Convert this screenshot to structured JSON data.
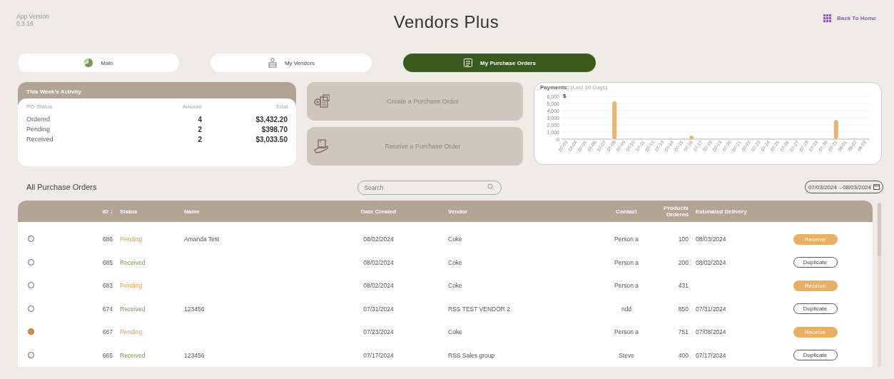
{
  "header": {
    "version_label": "App Version",
    "version": "0.3.16",
    "title": "Vendors Plus",
    "back_link": "Back To Home"
  },
  "tabs": [
    {
      "label": "Main",
      "selected": false
    },
    {
      "label": "My Vendors",
      "selected": false
    },
    {
      "label": "My Purchase Orders",
      "selected": true
    }
  ],
  "activity": {
    "title": "This Week's Activity",
    "columns": [
      "PO Status",
      "Amount",
      "Total"
    ],
    "rows": [
      {
        "status": "Ordered",
        "amount": "4",
        "total": "$3,432.20"
      },
      {
        "status": "Pending",
        "amount": "2",
        "total": "$398.70"
      },
      {
        "status": "Received",
        "amount": "2",
        "total": "$3,033.50"
      }
    ]
  },
  "actions": [
    {
      "label": "Create a Purchase Order"
    },
    {
      "label": "Receive a Purchase Order"
    }
  ],
  "payments": {
    "subtitle": "(Last 30 Days)",
    "chart_data": {
      "type": "bar",
      "title": "Payments:",
      "ylabel": "$",
      "categories": [
        "07-03",
        "07-04",
        "07-05",
        "07-06",
        "07-07",
        "07-08",
        "07-09",
        "07-10",
        "07-11",
        "07-12",
        "07-13",
        "07-14",
        "07-15",
        "07-16",
        "07-17",
        "07-18",
        "07-19",
        "07-20",
        "07-21",
        "07-22",
        "07-23",
        "07-24",
        "07-25",
        "07-26",
        "07-27",
        "07-28",
        "07-29",
        "07-30",
        "07-31",
        "08-01",
        "08-02",
        "08-03"
      ],
      "grid": true,
      "series": [
        {
          "color": "#e8b56e",
          "values": [
            0,
            0,
            0,
            0,
            0,
            5300,
            0,
            0,
            0,
            0,
            0,
            0,
            0,
            500,
            0,
            0,
            0,
            0,
            0,
            0,
            0,
            0,
            0,
            0,
            0,
            0,
            0,
            0,
            2700,
            0,
            0,
            0
          ]
        }
      ],
      "ylim": [
        0,
        6000
      ],
      "yticks": [
        0,
        {
          "value": 1000,
          "label": "1,000"
        },
        {
          "value": 2000,
          "label": "2,000"
        },
        {
          "value": 3000,
          "label": "3,000"
        },
        {
          "value": 4000,
          "label": "4,000"
        },
        {
          "value": 5000,
          "label": "5,000"
        },
        {
          "value": 6000,
          "label": "6,000"
        }
      ]
    }
  },
  "orders": {
    "title": "All Purchase Orders",
    "search": {
      "placeholder": "Search"
    },
    "date_range": "07/03/2024→08/03/2024",
    "columns": [
      "ID ↓",
      "Status",
      "Name",
      "Date Created",
      "Vendor",
      "Contact",
      "Products Ordered",
      "Estimated Delivery"
    ],
    "rows": [
      {
        "selected": false,
        "id": "686",
        "status": "Pending",
        "kind": "pending",
        "name": "Amanda Test",
        "date": "08/02/2024",
        "vendor": "Coke",
        "contact": "Person a",
        "products": "100",
        "delivery": "08/03/2024",
        "action": {
          "kind": "receive",
          "label": "Receive"
        }
      },
      {
        "selected": false,
        "id": "685",
        "status": "Received",
        "kind": "received",
        "date": "08/02/2024",
        "vendor": "Coke",
        "contact": "Person a",
        "products": "200",
        "delivery": "08/02/2024",
        "action": {
          "kind": "duplicate",
          "label": "Duplicate"
        }
      },
      {
        "selected": false,
        "id": "683",
        "status": "Pending",
        "kind": "pending",
        "date": "08/02/2024",
        "vendor": "Coke",
        "contact": "Person a",
        "products": "431",
        "action": {
          "kind": "receive",
          "label": "Receive"
        }
      },
      {
        "selected": false,
        "id": "674",
        "status": "Received",
        "kind": "received",
        "name": "123456",
        "date": "07/31/2024",
        "vendor": "RSS TEST VENDOR 2",
        "contact": "ndd",
        "products": "850",
        "delivery": "07/31/2024",
        "action": {
          "kind": "duplicate",
          "label": "Duplicate"
        }
      },
      {
        "selected": true,
        "id": "667",
        "status": "Pending",
        "kind": "pending",
        "date": "07/23/2024",
        "vendor": "Coke",
        "contact": "Person a",
        "products": "751",
        "delivery": "07/08/2024",
        "action": {
          "kind": "receive",
          "label": "Receive"
        }
      },
      {
        "selected": false,
        "id": "665",
        "status": "Received",
        "kind": "received",
        "name": "123456",
        "date": "07/17/2024",
        "vendor": "RSS Sales group",
        "contact": "Steve",
        "products": "400",
        "delivery": "07/17/2024",
        "action": {
          "kind": "duplicate",
          "label": "Duplicate"
        }
      }
    ]
  }
}
